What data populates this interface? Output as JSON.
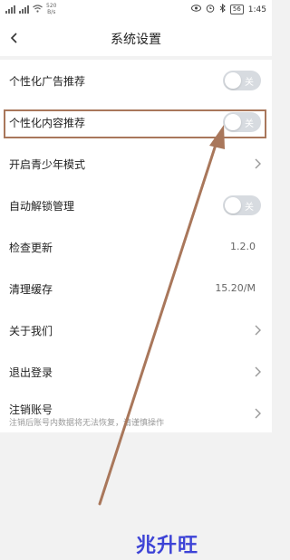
{
  "status_bar": {
    "network_speed": "520",
    "network_unit": "B/s",
    "battery": "56",
    "time": "1:45"
  },
  "nav": {
    "title": "系统设置"
  },
  "settings": {
    "ad_recommend": {
      "label": "个性化广告推荐",
      "toggle_text": "关",
      "enabled": false
    },
    "content_recommend": {
      "label": "个性化内容推荐",
      "toggle_text": "关",
      "enabled": false
    },
    "teen_mode": {
      "label": "开启青少年模式"
    },
    "auto_unlock": {
      "label": "自动解锁管理",
      "toggle_text": "关",
      "enabled": false
    },
    "check_update": {
      "label": "检查更新",
      "value": "1.2.0"
    },
    "clear_cache": {
      "label": "清理缓存",
      "value": "15.20/M"
    },
    "about": {
      "label": "关于我们"
    },
    "logout": {
      "label": "退出登录"
    },
    "cancel_account": {
      "label": "注销账号",
      "subtext": "注销后账号内数据将无法恢复，请谨慎操作"
    }
  },
  "watermark": {
    "text": "兆升旺"
  },
  "colors": {
    "highlight": "#a9775b",
    "toggle_off": "#d7dbe0",
    "watermark": "#3d43d6"
  }
}
